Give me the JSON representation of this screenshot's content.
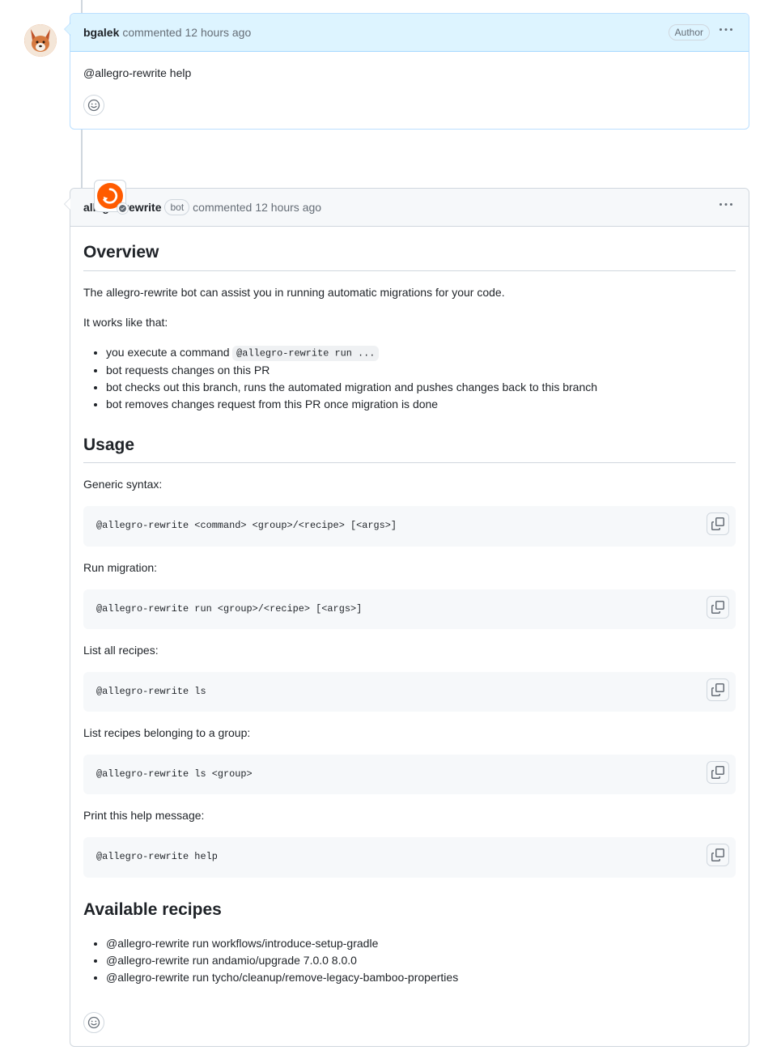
{
  "comment1": {
    "author": "bgalek",
    "action": "commented",
    "time": "12 hours ago",
    "badge": "Author",
    "body": "@allegro-rewrite help"
  },
  "comment2": {
    "author": "allegro-rewrite",
    "bot_label": "bot",
    "action": "commented",
    "time": "12 hours ago",
    "h_overview": "Overview",
    "p_intro": "The allegro-rewrite bot can assist you in running automatic migrations for your code.",
    "p_works": "It works like that:",
    "li1_a": "you execute a command ",
    "li1_code": "@allegro-rewrite run ...",
    "li2": "bot requests changes on this PR",
    "li3": "bot checks out this branch, runs the automated migration and pushes changes back to this branch",
    "li4": "bot removes changes request from this PR once migration is done",
    "h_usage": "Usage",
    "p_generic": "Generic syntax:",
    "code_generic": "@allegro-rewrite <command> <group>/<recipe> [<args>]",
    "p_run": "Run migration:",
    "code_run": "@allegro-rewrite run <group>/<recipe> [<args>]",
    "p_ls": "List all recipes:",
    "code_ls": "@allegro-rewrite ls",
    "p_lsg": "List recipes belonging to a group:",
    "code_lsg": "@allegro-rewrite ls <group>",
    "p_help": "Print this help message:",
    "code_help": "@allegro-rewrite help",
    "h_recipes": "Available recipes",
    "r1": "@allegro-rewrite run workflows/introduce-setup-gradle",
    "r2": "@allegro-rewrite run andamio/upgrade 7.0.0 8.0.0",
    "r3": "@allegro-rewrite run tycho/cleanup/remove-legacy-bamboo-properties"
  }
}
